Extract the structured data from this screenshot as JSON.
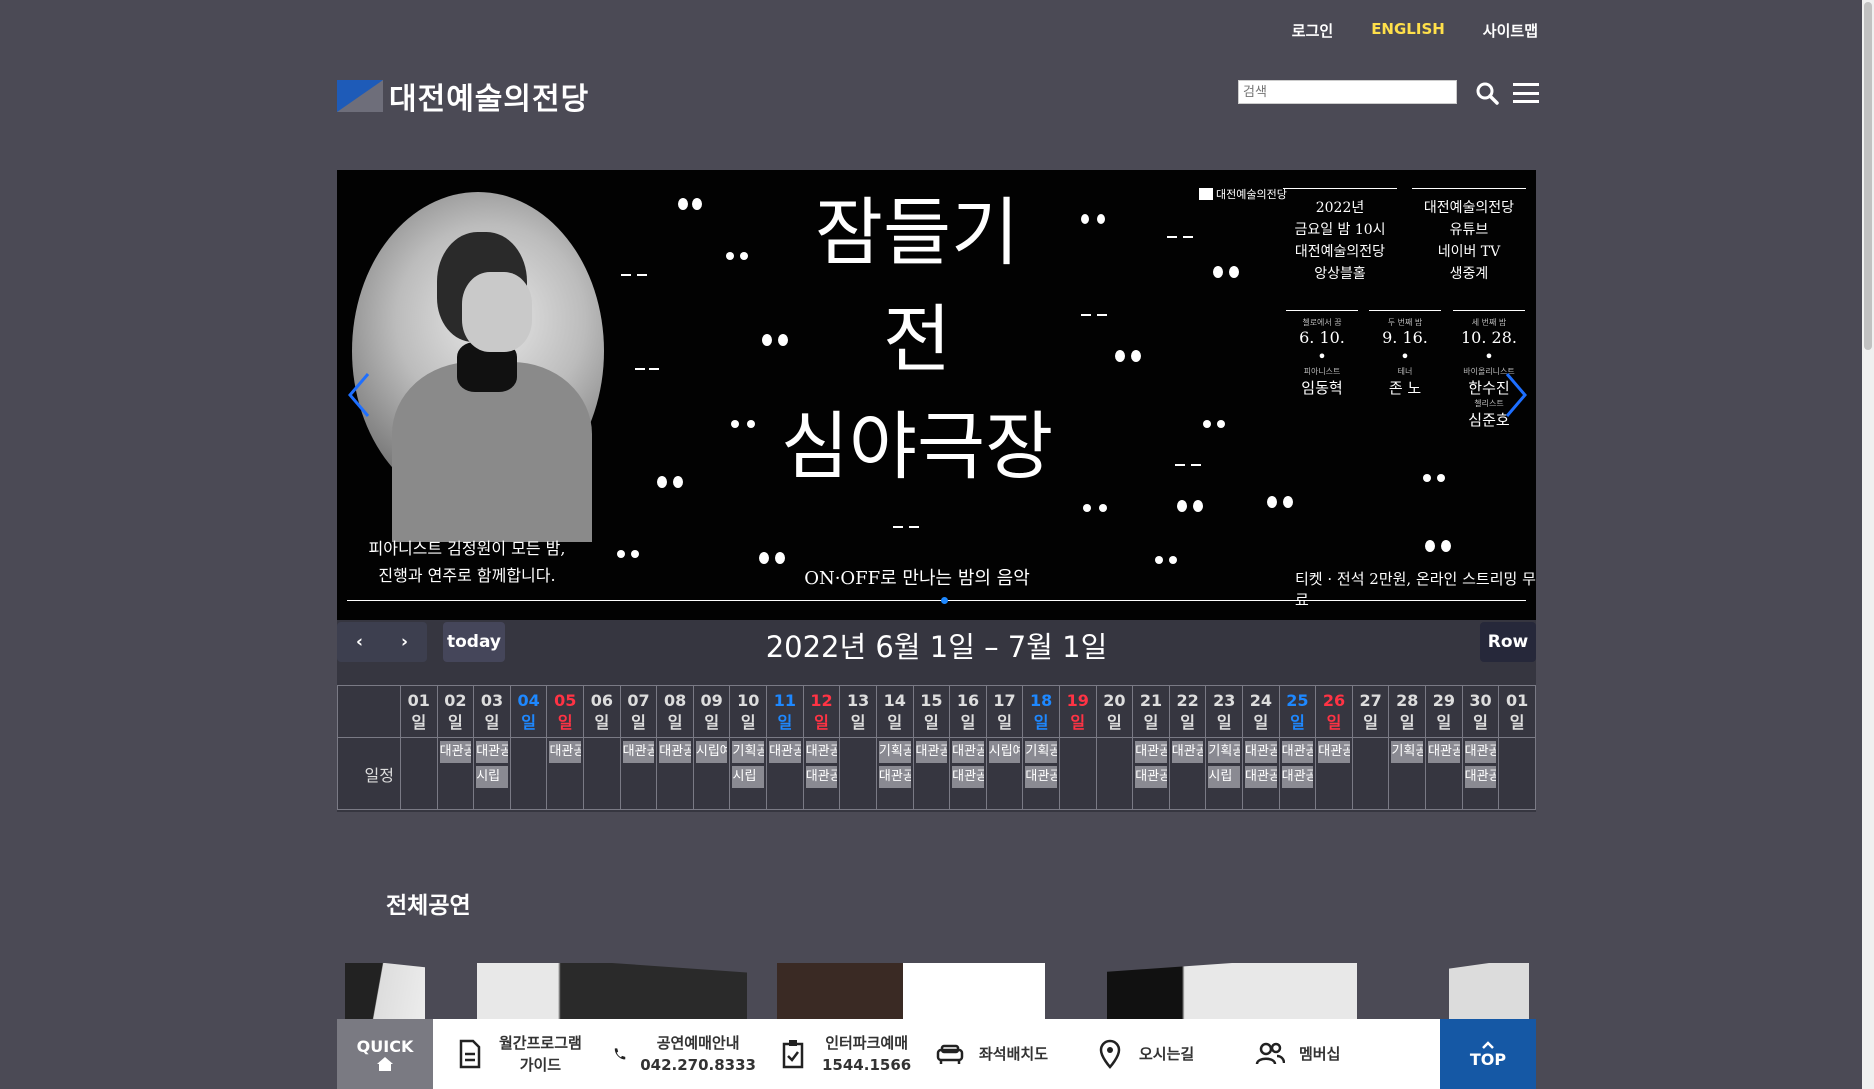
{
  "header": {
    "links": [
      {
        "label": "로그인",
        "key": "login"
      },
      {
        "label": "ENGLISH",
        "key": "english"
      },
      {
        "label": "사이트맵",
        "key": "sitemap"
      }
    ],
    "logo_text": "대전예술의전당",
    "search_placeholder": "검색",
    "accent_color": "#ffe04a"
  },
  "banner": {
    "title_lines": [
      "잠들기",
      "전",
      "심야극장"
    ],
    "subtitle": "ON·OFF로 만나는 밤의 음악",
    "caption_left": [
      "피아니스트 김정원이 모든 밤,",
      "진행과 연주로 함께합니다."
    ],
    "mini_logo": "대전예술의전당",
    "info_left": [
      "2022년",
      "금요일 밤 10시",
      "대전예술의전당",
      "앙상블홀"
    ],
    "info_right": [
      "대전예술의전당",
      "유튜브",
      "네이버 TV",
      "생중계"
    ],
    "performances": [
      {
        "role": "첼로에서 꿈",
        "date": "6. 10.",
        "sub": "피아니스트",
        "name": "임동혁"
      },
      {
        "role": "두 번째 밤",
        "date": "9. 16.",
        "sub": "테너",
        "name": "존 노"
      },
      {
        "role": "세 번째 밤",
        "date": "10. 28.",
        "sub": "바이올리니스트",
        "name": "한수진",
        "sub2": "첼리스트",
        "name2": "심준호"
      }
    ],
    "caption_right": "티켓 · 전석 2만원, 온라인 스트리밍 무료"
  },
  "calendar": {
    "prev": "‹",
    "next": "›",
    "today_label": "today",
    "title": "2022년 6월 1일 – 7월 1일",
    "view_label": "Row",
    "row_label": "일정",
    "days": [
      {
        "d": "01",
        "t": ""
      },
      {
        "d": "02",
        "t": ""
      },
      {
        "d": "03",
        "t": ""
      },
      {
        "d": "04",
        "t": "sat"
      },
      {
        "d": "05",
        "t": "sun"
      },
      {
        "d": "06",
        "t": ""
      },
      {
        "d": "07",
        "t": ""
      },
      {
        "d": "08",
        "t": ""
      },
      {
        "d": "09",
        "t": ""
      },
      {
        "d": "10",
        "t": ""
      },
      {
        "d": "11",
        "t": "sat"
      },
      {
        "d": "12",
        "t": "sun"
      },
      {
        "d": "13",
        "t": ""
      },
      {
        "d": "14",
        "t": ""
      },
      {
        "d": "15",
        "t": ""
      },
      {
        "d": "16",
        "t": ""
      },
      {
        "d": "17",
        "t": ""
      },
      {
        "d": "18",
        "t": "sat"
      },
      {
        "d": "19",
        "t": "sun"
      },
      {
        "d": "20",
        "t": ""
      },
      {
        "d": "21",
        "t": ""
      },
      {
        "d": "22",
        "t": ""
      },
      {
        "d": "23",
        "t": ""
      },
      {
        "d": "24",
        "t": ""
      },
      {
        "d": "25",
        "t": "sat"
      },
      {
        "d": "26",
        "t": "sun"
      },
      {
        "d": "27",
        "t": ""
      },
      {
        "d": "28",
        "t": ""
      },
      {
        "d": "29",
        "t": ""
      },
      {
        "d": "30",
        "t": ""
      },
      {
        "d": "01",
        "t": ""
      }
    ],
    "day_suffix": "일",
    "events": [
      [],
      [
        "대관공연"
      ],
      [
        "대관공연",
        "시립"
      ],
      [],
      [
        "대관공연"
      ],
      [],
      [
        "대관공연"
      ],
      [
        "대관공연"
      ],
      [
        "시립예술단"
      ],
      [
        "기획공연",
        "시립"
      ],
      [
        "대관공연"
      ],
      [
        "대관공연",
        "대관공연"
      ],
      [],
      [
        "기획공연",
        "대관공연"
      ],
      [
        "대관공연"
      ],
      [
        "대관공연",
        "대관공연"
      ],
      [
        "시립예술단"
      ],
      [
        "기획공연",
        "대관공연"
      ],
      [],
      [],
      [
        "대관공연",
        "대관공연"
      ],
      [
        "대관공연"
      ],
      [
        "기획공연",
        "시립"
      ],
      [
        "대관공연",
        "대관공연"
      ],
      [
        "대관공연",
        "대관공연"
      ],
      [
        "대관공연"
      ],
      [],
      [
        "기획공연"
      ],
      [
        "대관공연"
      ],
      [
        "대관공연",
        "대관공연"
      ],
      []
    ],
    "sat_color": "#1e88ff",
    "sun_color": "#ff3344"
  },
  "section": {
    "title": "전체공연"
  },
  "quickbar": {
    "quick_label": "QUICK",
    "items": [
      {
        "line1": "월간프로그램",
        "line2": "가이드",
        "icon": "document-icon"
      },
      {
        "line1": "공연예매안내",
        "line2": "042.270.8333",
        "icon": "phone-icon"
      },
      {
        "line1": "인터파크예매",
        "line2": "1544.1566",
        "icon": "clipboard-icon"
      },
      {
        "line1": "좌석배치도",
        "line2": "",
        "icon": "seat-icon"
      },
      {
        "line1": "오시는길",
        "line2": "",
        "icon": "map-pin-icon"
      },
      {
        "line1": "멤버십",
        "line2": "",
        "icon": "users-icon"
      }
    ],
    "top_label": "TOP",
    "top_color": "#1558a5"
  }
}
